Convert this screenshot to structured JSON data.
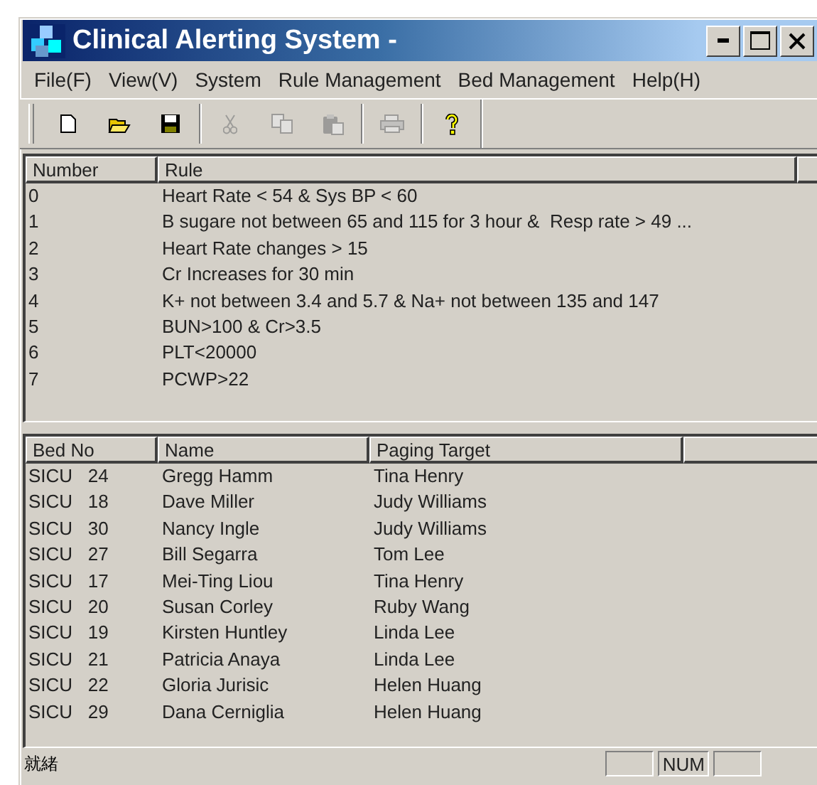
{
  "window": {
    "title": "Clinical Alerting System -"
  },
  "menu": [
    "File(F)",
    "View(V)",
    "System",
    "Rule Management",
    "Bed Management",
    "Help(H)"
  ],
  "toolbar": [
    {
      "kind": "new",
      "disabled": false
    },
    {
      "kind": "open",
      "disabled": false
    },
    {
      "kind": "save",
      "disabled": false
    },
    {
      "kind": "separator"
    },
    {
      "kind": "cut",
      "disabled": true
    },
    {
      "kind": "copy",
      "disabled": true
    },
    {
      "kind": "paste",
      "disabled": true
    },
    {
      "kind": "separator"
    },
    {
      "kind": "print",
      "disabled": true
    },
    {
      "kind": "separator"
    },
    {
      "kind": "help",
      "disabled": false
    }
  ],
  "rules_table": {
    "columns": [
      "Number",
      "Rule"
    ],
    "rows": [
      [
        "0",
        "Heart Rate < 54 & Sys BP < 60"
      ],
      [
        "1",
        "B sugare not between 65 and 115 for 3 hour &  Resp rate > 49 ..."
      ],
      [
        "2",
        "Heart Rate changes > 15"
      ],
      [
        "3",
        "Cr Increases for 30 min"
      ],
      [
        "4",
        "K+ not between 3.4 and 5.7 & Na+ not between 135 and 147"
      ],
      [
        "5",
        "BUN>100 & Cr>3.5"
      ],
      [
        "6",
        "PLT<20000"
      ],
      [
        "7",
        "PCWP>22"
      ]
    ]
  },
  "beds_table": {
    "columns": [
      "Bed No",
      "Name",
      "Paging Target"
    ],
    "rows": [
      [
        "SICU   24",
        "Gregg Hamm",
        "Tina Henry"
      ],
      [
        "SICU   18",
        "Dave Miller",
        "Judy Williams"
      ],
      [
        "SICU   30",
        "Nancy Ingle",
        "Judy Williams"
      ],
      [
        "SICU   27",
        "Bill Segarra",
        "Tom Lee"
      ],
      [
        "SICU   17",
        "Mei-Ting Liou",
        "Tina Henry"
      ],
      [
        "SICU   20",
        "Susan Corley",
        "Ruby Wang"
      ],
      [
        "SICU   19",
        "Kirsten Huntley",
        "Linda Lee"
      ],
      [
        "SICU   21",
        "Patricia Anaya",
        "Linda Lee"
      ],
      [
        "SICU   22",
        "Gloria Jurisic",
        "Helen Huang"
      ],
      [
        "SICU   29",
        "Dana Cerniglia",
        "Helen Huang"
      ]
    ]
  },
  "status_bar": {
    "message": "就緒",
    "indicators": [
      "NUM"
    ]
  }
}
